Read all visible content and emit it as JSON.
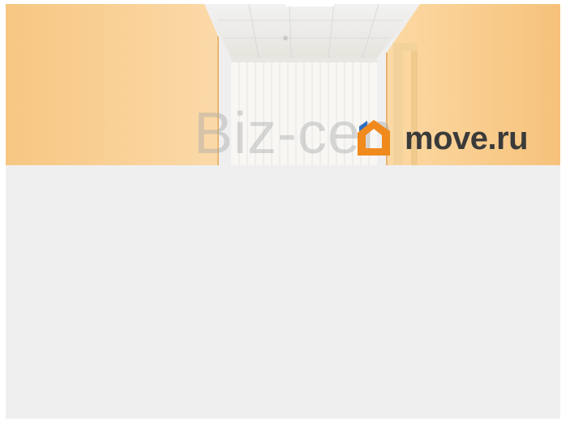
{
  "photo": {
    "watermark_text": "Biz-cen",
    "brand_name": "move.ru",
    "logo_icon": "house-logo-icon",
    "colors": {
      "wall": "#f6cf96",
      "ceiling": "#eeeeee",
      "window": "#f7f7f5",
      "logo_orange": "#f08a1c",
      "logo_blue": "#2f6fc1",
      "brand_text": "#3a3a3a",
      "background": "#efefef"
    }
  }
}
